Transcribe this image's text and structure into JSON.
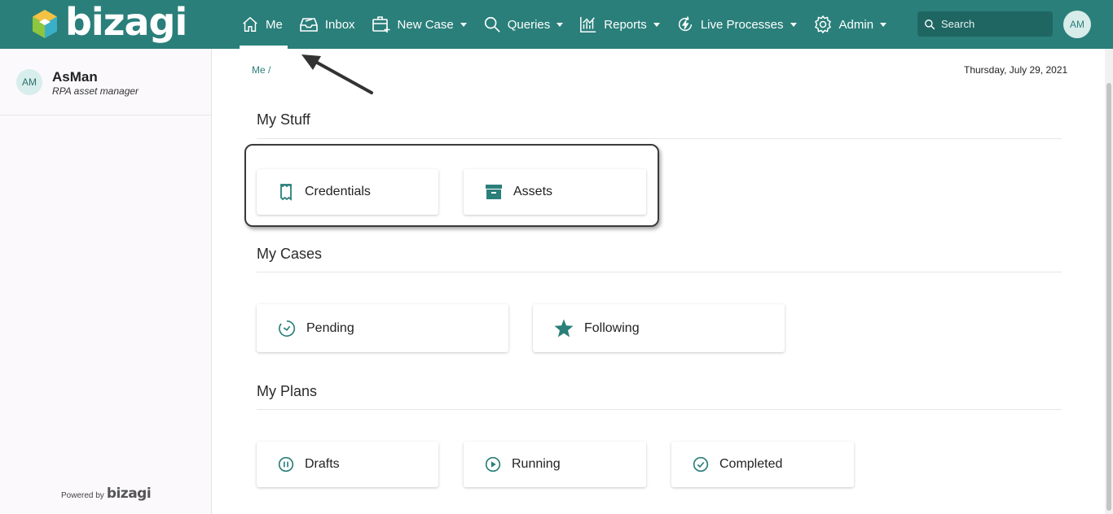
{
  "brand": {
    "name": "bizagi"
  },
  "nav": {
    "items": [
      {
        "label": "Me",
        "icon": "home-icon",
        "active": true
      },
      {
        "label": "Inbox",
        "icon": "inbox-icon"
      },
      {
        "label": "New Case",
        "icon": "new-case-icon",
        "dropdown": true
      },
      {
        "label": "Queries",
        "icon": "search-icon",
        "dropdown": true
      },
      {
        "label": "Reports",
        "icon": "reports-icon",
        "dropdown": true
      },
      {
        "label": "Live Processes",
        "icon": "live-processes-icon",
        "dropdown": true
      },
      {
        "label": "Admin",
        "icon": "gear-icon",
        "dropdown": true
      }
    ]
  },
  "search": {
    "placeholder": "Search"
  },
  "user": {
    "initials": "AM",
    "name": "AsMan",
    "role": "RPA asset manager"
  },
  "sidebar": {
    "powered_prefix": "Powered by",
    "powered_brand": "bizagi"
  },
  "main": {
    "breadcrumb": "Me /",
    "date": "Thursday, July 29, 2021",
    "sections": {
      "my_stuff": {
        "title": "My Stuff",
        "tiles": [
          {
            "label": "Credentials",
            "icon": "credentials-icon"
          },
          {
            "label": "Assets",
            "icon": "archive-icon"
          }
        ]
      },
      "my_cases": {
        "title": "My Cases",
        "tiles": [
          {
            "label": "Pending",
            "icon": "timer-icon"
          },
          {
            "label": "Following",
            "icon": "star-icon"
          }
        ]
      },
      "my_plans": {
        "title": "My Plans",
        "tiles": [
          {
            "label": "Drafts",
            "icon": "pause-circle-icon"
          },
          {
            "label": "Running",
            "icon": "play-circle-icon"
          },
          {
            "label": "Completed",
            "icon": "check-circle-icon"
          }
        ]
      }
    }
  },
  "colors": {
    "primary": "#2a7f7a",
    "search_bg": "#1f6662",
    "sidebar_bg": "#fbf9fc"
  }
}
